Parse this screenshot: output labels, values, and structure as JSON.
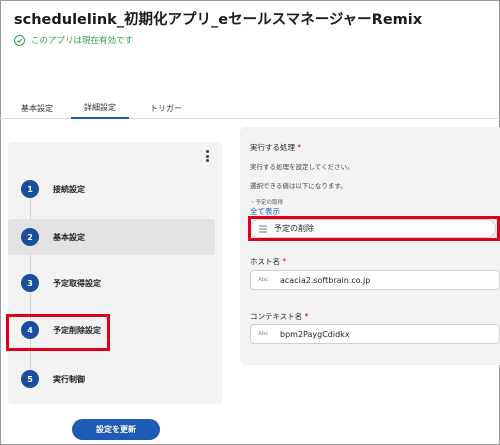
{
  "app": {
    "title": "schedulelink_初期化アプリ_eセールスマネージャーRemix",
    "status_text": "このアプリは現在有効です"
  },
  "tabs": [
    {
      "label": "基本設定",
      "active": false
    },
    {
      "label": "詳細設定",
      "active": true
    },
    {
      "label": "トリガー",
      "active": false
    }
  ],
  "steps": [
    {
      "number": "1",
      "label": "接続設定",
      "selected": false
    },
    {
      "number": "2",
      "label": "基本設定",
      "selected": true
    },
    {
      "number": "3",
      "label": "予定取得設定",
      "selected": false
    },
    {
      "number": "4",
      "label": "予定削除設定",
      "selected": false
    },
    {
      "number": "5",
      "label": "実行制御",
      "selected": false
    }
  ],
  "update_button": "設定を更新",
  "form": {
    "action": {
      "label": "実行する処理",
      "help1": "実行する処理を設定してください。",
      "help2": "選択できる値は以下になります。",
      "option_hint": "・予定の取得",
      "show_all": "全て表示",
      "selected_value": "予定の削除"
    },
    "host": {
      "label": "ホスト名",
      "type_icon": "Abc",
      "value": "acacia2.softbrain.co.jp"
    },
    "context": {
      "label": "コンテキスト名",
      "type_icon": "Abc",
      "value": "bpm2PaygCdidkx"
    },
    "required_mark": "*"
  },
  "colors": {
    "accent": "#1f5ab4",
    "step_circle": "#1b4f9c",
    "status_green": "#2e9e4f",
    "highlight_red": "#e0001a"
  },
  "icons": {
    "status": "check-circle-icon",
    "menu": "kebab-menu-icon",
    "select": "list-icon"
  }
}
